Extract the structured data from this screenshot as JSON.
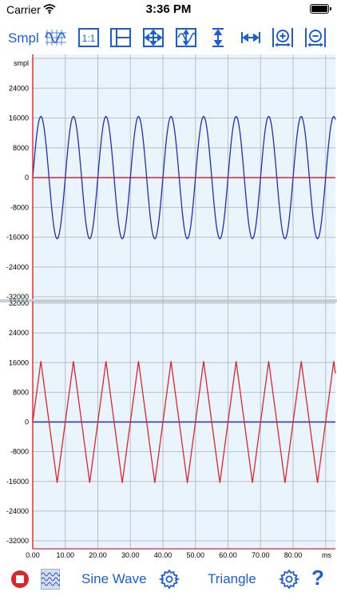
{
  "status_bar": {
    "carrier": "Carrier",
    "time": "3:36 PM"
  },
  "toolbar": {
    "smpl_label": "Smpl",
    "zoom_one_label": "1:1",
    "icons": [
      "waveform-grid-icon",
      "zoom-one-to-one-icon",
      "split-view-icon",
      "fit-all-icon",
      "fit-vertical-wave-icon",
      "vertical-resize-icon",
      "horizontal-resize-icon",
      "horizontal-zoom-in-icon",
      "horizontal-zoom-out-icon"
    ]
  },
  "bottom_bar": {
    "channel1_label": "Sine Wave",
    "channel2_label": "Triangle",
    "help_label": "?"
  },
  "colors": {
    "accent": "#1a5fd6",
    "plot_bg": "#eaf4fc",
    "grid": "#b9bfc6",
    "sine": "#1f2fb8",
    "triangle": "#e0242b",
    "stop": "#e0242b"
  },
  "chart_data": [
    {
      "type": "line",
      "ylabel": "smpl",
      "y_ticks": [
        "24000",
        "16000",
        "8000",
        "0",
        "-8000",
        "-16000",
        "-24000",
        "-32000"
      ],
      "ylim": [
        -32000,
        32000
      ],
      "xlim": [
        0,
        93
      ],
      "series": [
        {
          "name": "Sine Wave",
          "shape": "sine",
          "amplitude": 16384,
          "period_ms": 10,
          "color": "#1f2fb8"
        },
        {
          "shape": "zero-line",
          "value": 0,
          "color": "#e0242b"
        }
      ]
    },
    {
      "type": "line",
      "y_ticks": [
        "32000",
        "24000",
        "16000",
        "8000",
        "0",
        "-8000",
        "-16000",
        "-24000",
        "-32000"
      ],
      "ylim": [
        -32000,
        32000
      ],
      "xlim": [
        0,
        93
      ],
      "x_ticks": [
        "0.00",
        "10.00",
        "20.00",
        "30.00",
        "40.00",
        "50.00",
        "60.00",
        "70.00",
        "80.00"
      ],
      "xlabel": "ms",
      "series": [
        {
          "name": "Triangle",
          "shape": "triangle",
          "amplitude": 16384,
          "period_ms": 10,
          "color": "#e0242b"
        },
        {
          "shape": "zero-line",
          "value": 0,
          "color": "#1f2fb8"
        }
      ]
    }
  ]
}
